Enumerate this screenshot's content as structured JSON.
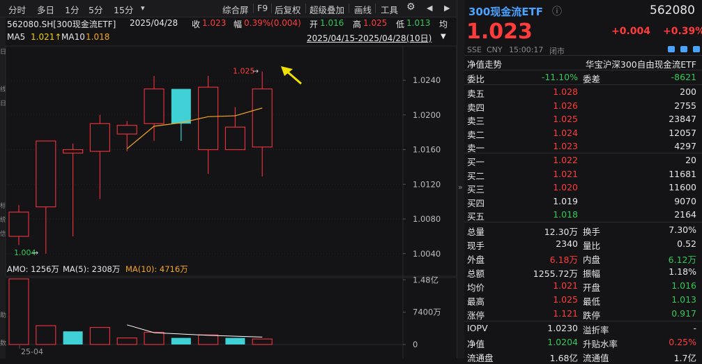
{
  "toolbar": {
    "left_items": [
      "分时",
      "多日",
      "1分",
      "5分",
      "15分"
    ],
    "dropdown_glyph": "▾",
    "right_items": [
      "综合屏",
      "F9",
      "后复权",
      "超级叠加",
      "画线",
      "工具"
    ],
    "gear_glyph": "⚙",
    "back_glyph": "◀",
    "forward_glyph": "▶"
  },
  "info": {
    "symbol_name": "562080.SH[300现金流ETF]",
    "date": "2025/04/28",
    "close_label": "收",
    "close_value": "1.023",
    "amp_label": "幅",
    "amp_value": "0.39%(0.004)",
    "open_label": "开",
    "open_value": "1.016",
    "high_label": "高",
    "high_value": "1.025",
    "low_label": "低",
    "low_value": "1.013",
    "extra_glyph": "均",
    "ma5_label": "MA5",
    "ma5_value": "1.021↑",
    "ma10_label": "MA10",
    "ma10_value": "1.018",
    "range": "2025/04/15-2025/04/28(10日)",
    "range_dropdown": "▼"
  },
  "chart_data": [
    {
      "type": "candlestick",
      "title": "",
      "y_ticks": [
        "1.0240",
        "1.0200",
        "1.0160",
        "1.0120",
        "1.0080",
        "1.0040"
      ],
      "ylim": [
        1.0035,
        1.0265
      ],
      "candles": [
        {
          "open": 1.006,
          "close": 1.0088,
          "high": 1.0096,
          "low": 1.005,
          "dir": "up"
        },
        {
          "open": 1.0094,
          "close": 1.017,
          "high": 1.017,
          "low": 1.004,
          "dir": "up"
        },
        {
          "open": 1.0156,
          "close": 1.016,
          "high": 1.0167,
          "low": 1.006,
          "dir": "up"
        },
        {
          "open": 1.0158,
          "close": 1.019,
          "high": 1.02,
          "low": 1.0103,
          "dir": "up"
        },
        {
          "open": 1.0188,
          "close": 1.0178,
          "high": 1.0193,
          "low": 1.0158,
          "dir": "up"
        },
        {
          "open": 1.019,
          "close": 1.023,
          "high": 1.0245,
          "low": 1.017,
          "dir": "up"
        },
        {
          "open": 1.023,
          "close": 1.019,
          "high": 1.023,
          "low": 1.017,
          "dir": "down"
        },
        {
          "open": 1.016,
          "close": 1.0232,
          "high": 1.0245,
          "low": 1.0132,
          "dir": "up"
        },
        {
          "open": 1.016,
          "close": 1.0186,
          "high": 1.0209,
          "low": 1.016,
          "dir": "up"
        },
        {
          "open": 1.0163,
          "close": 1.023,
          "high": 1.025,
          "low": 1.0129,
          "dir": "up"
        }
      ],
      "ma5": [
        null,
        null,
        null,
        null,
        1.0161,
        1.0187,
        1.0191,
        1.0198,
        1.0199,
        1.0208
      ],
      "low_marker": "1.004",
      "high_marker": "1.025",
      "arrow_glyph": "→"
    },
    {
      "type": "bar",
      "title": "",
      "labels": {
        "amo": "AMO: 1256万",
        "ma5": "MA(5): 2308万",
        "ma10": "MA(10): 4716万"
      },
      "y_ticks": [
        "1.48亿",
        "7400万",
        "0"
      ],
      "ylim": [
        0,
        15000
      ],
      "values": [
        15000,
        4300,
        3000,
        3900,
        1500,
        2800,
        1500,
        2200,
        1500,
        1256
      ],
      "dirs": [
        "up",
        "up",
        "down",
        "up",
        "up",
        "up",
        "down",
        "up",
        "down",
        "up"
      ],
      "ma10": [
        null,
        null,
        null,
        null,
        4500,
        2700,
        2400,
        2100,
        1900,
        1700
      ],
      "x_ticks": [
        "25-04"
      ]
    }
  ],
  "side_labels": [
    "日",
    "线",
    "日",
    "标",
    "统",
    "信",
    "助",
    "数"
  ],
  "right": {
    "title": "300现金流ETF",
    "info_glyph": "ⓘ",
    "code": "562080",
    "price": "1.023",
    "change": "+0.004",
    "change_pct": "+0.39%",
    "exchange": "SSE",
    "currency": "CNY",
    "time": "15:00:17",
    "status": "闭市",
    "nav_label": "净值走势",
    "fund_name": "华宝沪深300自由现金流ETF",
    "weibi_label": "委比",
    "weibi_value": "-11.10%",
    "weicha_label": "委差",
    "weicha_value": "-8621",
    "asks": [
      {
        "label": "卖五",
        "price": "1.028",
        "vol": "200"
      },
      {
        "label": "卖四",
        "price": "1.026",
        "vol": "2755"
      },
      {
        "label": "卖三",
        "price": "1.025",
        "vol": "23847"
      },
      {
        "label": "卖二",
        "price": "1.024",
        "vol": "12057"
      },
      {
        "label": "卖一",
        "price": "1.023",
        "vol": "4297"
      }
    ],
    "bids": [
      {
        "label": "买一",
        "price": "1.022",
        "vol": "20"
      },
      {
        "label": "买二",
        "price": "1.021",
        "vol": "11681"
      },
      {
        "label": "买三",
        "price": "1.020",
        "vol": "11600"
      },
      {
        "label": "买四",
        "price": "1.019",
        "vol": "9070"
      },
      {
        "label": "买五",
        "price": "1.018",
        "vol": "2164"
      }
    ],
    "stats": [
      {
        "l1": "总量",
        "v1": "12.30万",
        "c1": "white",
        "l2": "换手",
        "v2": "7.30%",
        "c2": "white"
      },
      {
        "l1": "现手",
        "v1": "2340",
        "c1": "white",
        "l2": "量比",
        "v2": "0.52",
        "c2": "white"
      },
      {
        "l1": "外盘",
        "v1": "6.18万",
        "c1": "red",
        "l2": "内盘",
        "v2": "6.12万",
        "c2": "green"
      },
      {
        "l1": "总额",
        "v1": "1255.72万",
        "c1": "white",
        "l2": "振幅",
        "v2": "1.18%",
        "c2": "white"
      },
      {
        "l1": "均价",
        "v1": "1.021",
        "c1": "red",
        "l2": "开盘",
        "v2": "1.016",
        "c2": "green"
      },
      {
        "l1": "最高",
        "v1": "1.025",
        "c1": "red",
        "l2": "最低",
        "v2": "1.013",
        "c2": "green"
      },
      {
        "l1": "涨停",
        "v1": "1.121",
        "c1": "red",
        "l2": "跌停",
        "v2": "0.917",
        "c2": "green"
      }
    ],
    "stats2": [
      {
        "l1": "IOPV",
        "v1": "1.0230",
        "c1": "white",
        "l2": "溢折率",
        "v2": "-",
        "c2": "white"
      },
      {
        "l1": "净值",
        "v1": "1.0204",
        "c1": "green",
        "l2": "升贴水率",
        "v2": "0.25%",
        "c2": "red"
      },
      {
        "l1": "流通盘",
        "v1": "1.68亿",
        "c1": "white",
        "l2": "流通值",
        "v2": "1.7亿",
        "c2": "white"
      }
    ]
  },
  "colors": {
    "up": "#e0303a",
    "down": "#3fd1d6",
    "ma5": "#f5a623",
    "ma10": "#ffffff",
    "red": "#ff3b3b",
    "green": "#34c759"
  }
}
